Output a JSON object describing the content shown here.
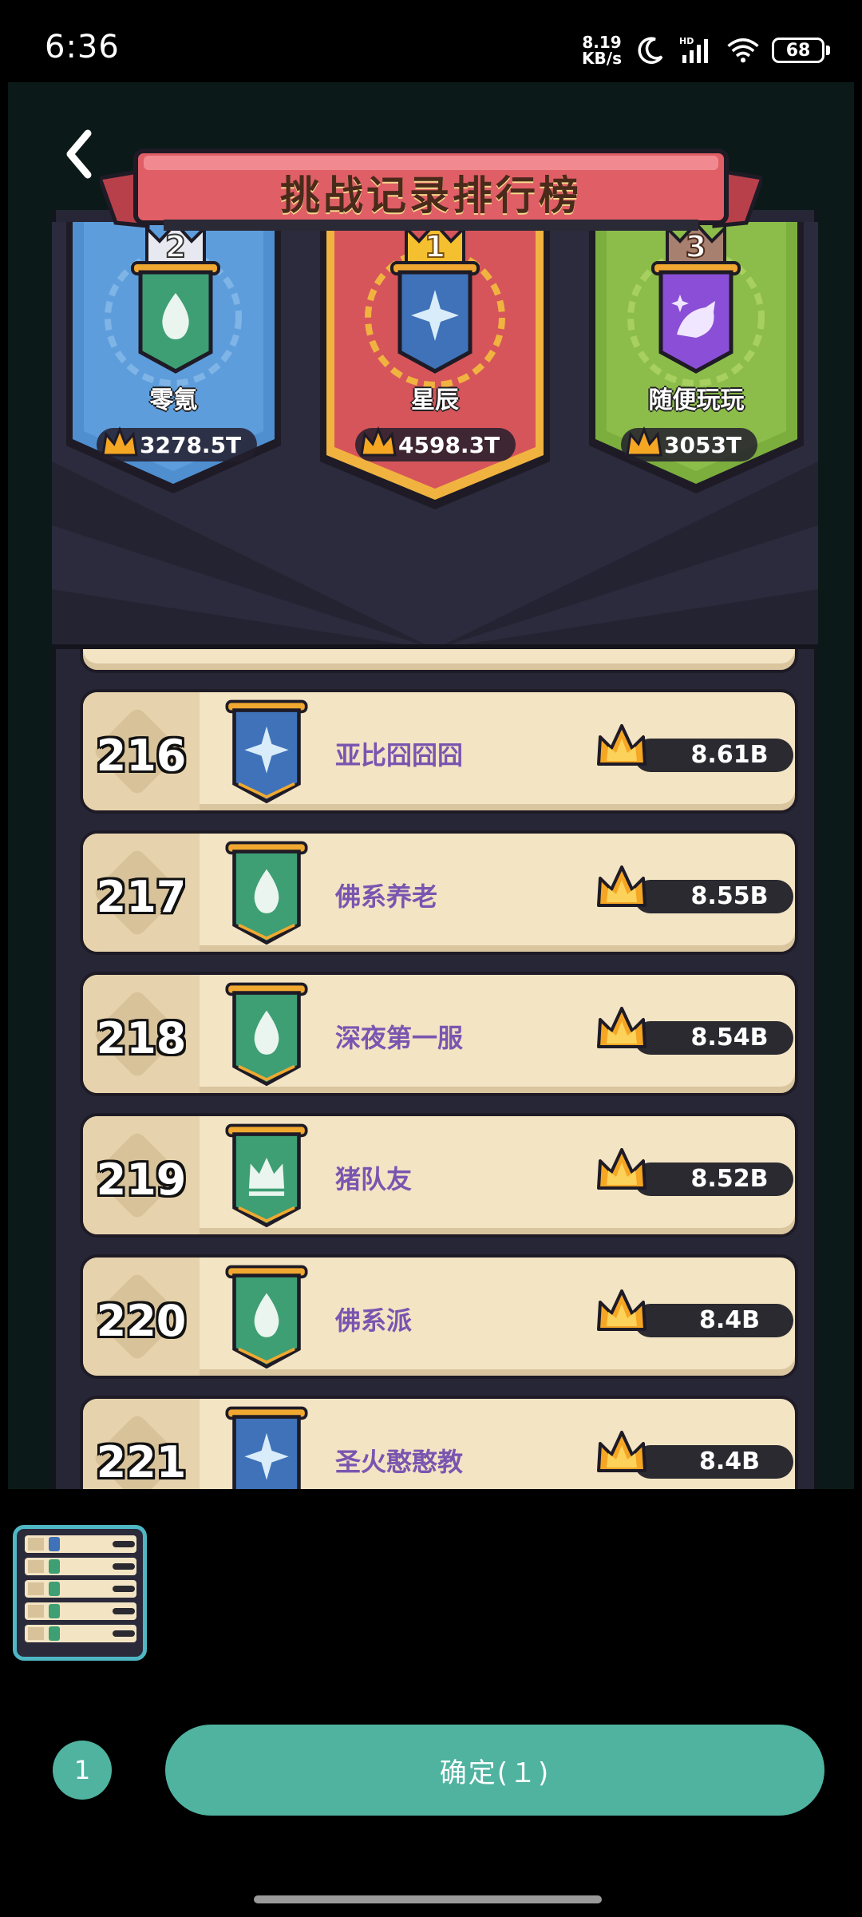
{
  "status_bar": {
    "time": "6:36",
    "net_speed_value": "8.19",
    "net_speed_unit": "KB/s",
    "battery": "68",
    "network_label": "HD"
  },
  "game": {
    "title": "挑战记录排行榜",
    "podium": [
      {
        "rank": "2",
        "name": "零氪",
        "score": "3278.5T",
        "color": "#4f8fd0",
        "emblem": "drop"
      },
      {
        "rank": "1",
        "name": "星辰",
        "score": "4598.3T",
        "color": "#d6555a",
        "emblem": "star"
      },
      {
        "rank": "3",
        "name": "随便玩玩",
        "score": "3053T",
        "color": "#7cae3e",
        "emblem": "bird"
      }
    ],
    "rows": [
      {
        "rank": "216",
        "name": "亚比囧囧囧",
        "score": "8.61B",
        "emblem": "star",
        "emblem_color": "#3f72b8"
      },
      {
        "rank": "217",
        "name": "佛系养老",
        "score": "8.55B",
        "emblem": "drop",
        "emblem_color": "#3e9e74"
      },
      {
        "rank": "218",
        "name": "深夜第一服",
        "score": "8.54B",
        "emblem": "drop",
        "emblem_color": "#3e9e74"
      },
      {
        "rank": "219",
        "name": "猪队友",
        "score": "8.52B",
        "emblem": "crown",
        "emblem_color": "#3e9e74"
      },
      {
        "rank": "220",
        "name": "佛系派",
        "score": "8.4B",
        "emblem": "drop",
        "emblem_color": "#3e9e74"
      },
      {
        "rank": "221",
        "name": "圣火憨憨教",
        "score": "8.4B",
        "emblem": "star",
        "emblem_color": "#3f72b8"
      }
    ]
  },
  "picker": {
    "selected_count": "1",
    "confirm_label": "确定(１)"
  }
}
